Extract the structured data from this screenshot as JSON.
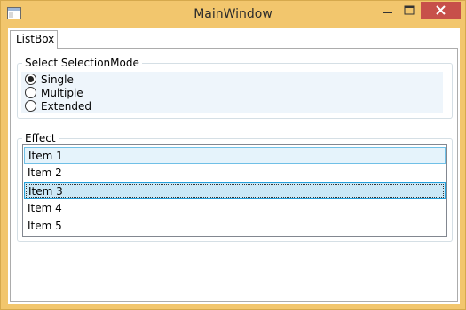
{
  "window": {
    "title": "MainWindow",
    "controls": [
      "minimize",
      "maximize",
      "close"
    ],
    "colors": {
      "frame": "#f2c66d",
      "close": "#c7504a"
    }
  },
  "tabs": [
    {
      "label": "ListBox",
      "selected": true
    }
  ],
  "selection_group": {
    "header": "Select SelectionMode",
    "options": [
      {
        "label": "Single",
        "checked": true
      },
      {
        "label": "Multiple",
        "checked": false
      },
      {
        "label": "Extended",
        "checked": false
      }
    ]
  },
  "effect_group": {
    "header": "Effect",
    "items": [
      {
        "label": "Item 1",
        "state": "hover"
      },
      {
        "label": "Item 2",
        "state": "normal"
      },
      {
        "label": "Item 3",
        "state": "selected"
      },
      {
        "label": "Item 4",
        "state": "normal"
      },
      {
        "label": "Item 5",
        "state": "normal"
      }
    ]
  }
}
